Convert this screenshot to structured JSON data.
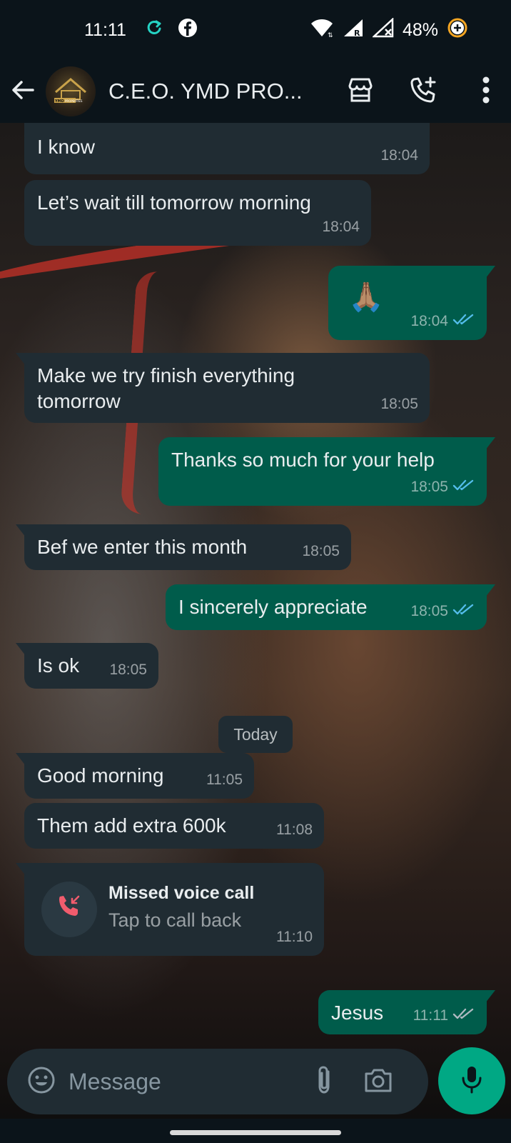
{
  "status_bar": {
    "time": "11:11",
    "battery": "48%",
    "icons": [
      "sync-icon",
      "facebook-icon",
      "wifi-icon",
      "signal-roaming-icon",
      "signal-no-service-icon",
      "battery-saver-icon"
    ]
  },
  "header": {
    "contact_name": "C.E.O. YMD PRO...",
    "avatar_text": "YMD PROPERTIES",
    "icons": [
      "back-arrow-icon",
      "store-icon",
      "add-call-icon",
      "more-vert-icon"
    ]
  },
  "messages": [
    {
      "dir": "in",
      "text": "I know",
      "time": "18:04"
    },
    {
      "dir": "in",
      "text": "Let’s wait till tomorrow morning",
      "time": "18:04"
    },
    {
      "dir": "out",
      "text": "🙏🏽",
      "time": "18:04",
      "ticks": "✓✓"
    },
    {
      "dir": "in",
      "text": "Make we try finish everything tomorrow",
      "time": "18:05"
    },
    {
      "dir": "out",
      "text": "Thanks so much for your help",
      "time": "18:05",
      "ticks": "✓✓"
    },
    {
      "dir": "in",
      "text": "Bef we enter this month",
      "time": "18:05"
    },
    {
      "dir": "out",
      "text": "I sincerely appreciate",
      "time": "18:05",
      "ticks": "✓✓"
    },
    {
      "dir": "in",
      "text": "Is ok",
      "time": "18:05"
    },
    {
      "dir": "in",
      "text": "Good morning",
      "time": "11:05"
    },
    {
      "dir": "in",
      "text": "Them add extra 600k",
      "time": "11:08"
    },
    {
      "dir": "out",
      "text": "Jesus",
      "time": "11:11",
      "ticks": "✓✓"
    }
  ],
  "date_separator": "Today",
  "missed_call": {
    "title": "Missed voice call",
    "subtitle": "Tap to call back",
    "time": "11:10"
  },
  "composer": {
    "placeholder": "Message"
  },
  "colors": {
    "incoming_bubble": "#202c33",
    "outgoing_bubble": "#005c4b",
    "accent": "#00a884",
    "read_tick": "#53bdeb",
    "missed_call_red": "#f15c6d"
  }
}
